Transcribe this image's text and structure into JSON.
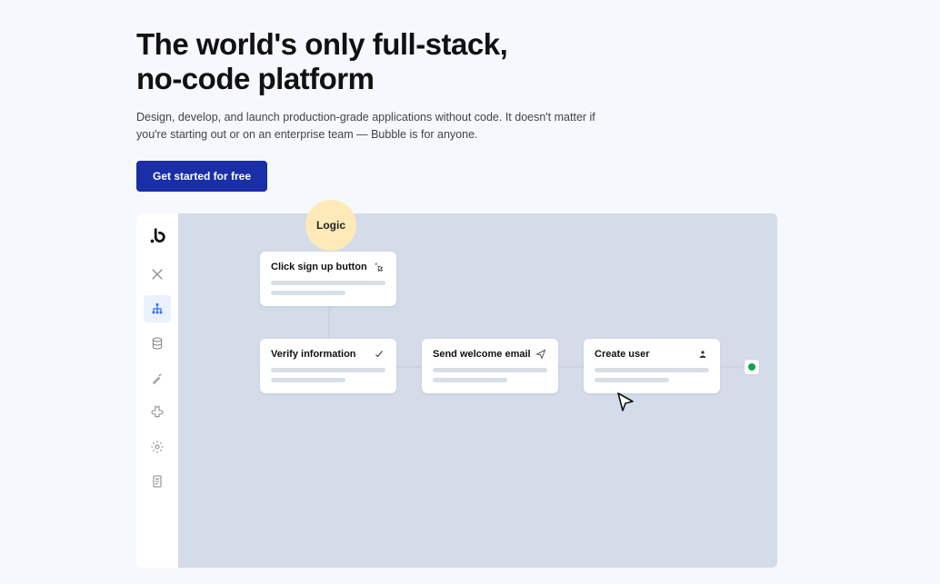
{
  "hero": {
    "headline_line1": "The world's only full-stack,",
    "headline_line2": "no-code platform",
    "subhead": "Design, develop, and launch production-grade applications without code. It doesn't matter if you're starting out or on an enterprise team — Bubble is for anyone.",
    "cta_label": "Get started for free"
  },
  "editor": {
    "chip_label": "Logic",
    "sidebar": {
      "items": [
        {
          "name": "design-icon",
          "active": false
        },
        {
          "name": "workflow-icon",
          "active": true
        },
        {
          "name": "data-icon",
          "active": false
        },
        {
          "name": "styles-icon",
          "active": false
        },
        {
          "name": "plugins-icon",
          "active": false
        },
        {
          "name": "settings-icon",
          "active": false
        },
        {
          "name": "logs-icon",
          "active": false
        }
      ]
    },
    "nodes": {
      "n1": {
        "label": "Click sign up button"
      },
      "n2": {
        "label": "Verify information"
      },
      "n3": {
        "label": "Send welcome email"
      },
      "n4": {
        "label": "Create user"
      }
    }
  }
}
